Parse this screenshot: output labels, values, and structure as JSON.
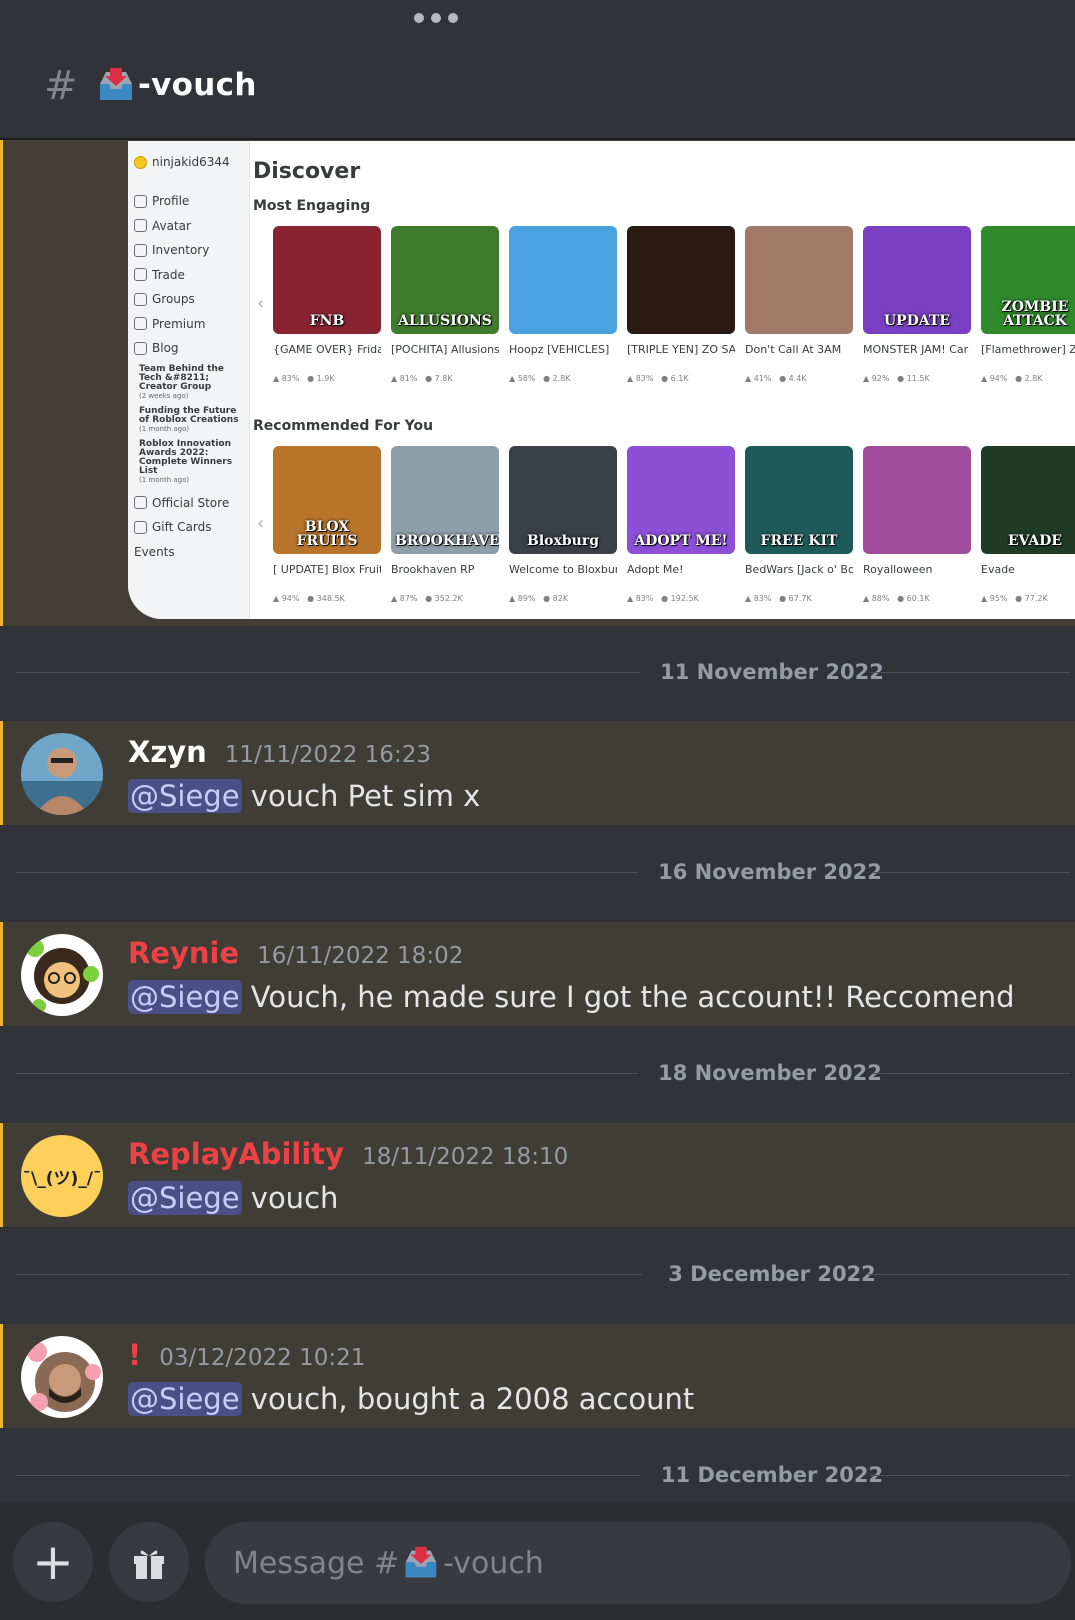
{
  "header": {
    "channel_prefix": "#",
    "channel_name": "-vouch",
    "menu_icon": "more-dots-icon",
    "channel_emoji": "inbox-tray-icon"
  },
  "embed": {
    "roblox": {
      "username": "ninjakid6344",
      "nav": [
        "Profile",
        "Avatar",
        "Inventory",
        "Trade",
        "Groups",
        "Premium",
        "Blog"
      ],
      "news": [
        {
          "title": "Team Behind the Tech &#8211; Creator Group",
          "age": "(2 weeks ago)"
        },
        {
          "title": "Funding the Future of Roblox Creations",
          "age": "(1 month ago)"
        },
        {
          "title": "Roblox Innovation Awards 2022: Complete Winners List",
          "age": "(1 month ago)"
        }
      ],
      "nav_bottom": [
        "Official Store",
        "Gift Cards",
        "Events"
      ],
      "page_title": "Discover",
      "section_1": "Most Engaging",
      "section_2": "Recommended For You",
      "most_engaging": [
        {
          "title": "{GAME OVER} Friday Night",
          "rating": "83%",
          "players": "1.9K",
          "thumb_text": "FNB",
          "color": "#8a2331"
        },
        {
          "title": "[POCHITA] Allusions",
          "rating": "81%",
          "players": "7.8K",
          "thumb_text": "ALLUSIONS",
          "color": "#3f7d2c"
        },
        {
          "title": "Hoopz [VEHICLES]",
          "rating": "58%",
          "players": "2.8K",
          "thumb_text": "",
          "color": "#4aa3e0"
        },
        {
          "title": "[TRIPLE YEN] ZO SAMURAI",
          "rating": "83%",
          "players": "6.1K",
          "thumb_text": "",
          "color": "#2a1a12"
        },
        {
          "title": "Don't Call At 3AM",
          "rating": "41%",
          "players": "4.4K",
          "thumb_text": "",
          "color": "#a07a66"
        },
        {
          "title": "MONSTER JAM! Car",
          "rating": "92%",
          "players": "11.5K",
          "thumb_text": "UPDATE",
          "color": "#7a3fc2"
        },
        {
          "title": "[Flamethrower] Zombie Attack",
          "rating": "94%",
          "players": "2.8K",
          "thumb_text": "ZOMBIE ATTACK",
          "color": "#2f8a2c"
        }
      ],
      "recommended": [
        {
          "title": "[ UPDATE] Blox Fruits",
          "rating": "94%",
          "players": "348.5K",
          "thumb_text": "BLOX FRUITS",
          "color": "#b8742a"
        },
        {
          "title": "Brookhaven RP",
          "rating": "87%",
          "players": "352.2K",
          "thumb_text": "BROOKHAVEN",
          "color": "#8e9ea8"
        },
        {
          "title": "Welcome to Bloxburg",
          "rating": "89%",
          "players": "82K",
          "thumb_text": "Bloxburg",
          "color": "#3b3f46"
        },
        {
          "title": "Adopt Me!",
          "rating": "83%",
          "players": "192.5K",
          "thumb_text": "ADOPT ME!",
          "color": "#8c4fd6"
        },
        {
          "title": "BedWars [Jack o' Boom!]",
          "rating": "83%",
          "players": "67.7K",
          "thumb_text": "FREE KIT",
          "color": "#1f5a5a"
        },
        {
          "title": "Royalloween",
          "rating": "88%",
          "players": "60.1K",
          "thumb_text": "",
          "color": "#a04b9e"
        },
        {
          "title": "Evade",
          "rating": "95%",
          "players": "77.2K",
          "thumb_text": "EVADE",
          "color": "#1f3b24"
        }
      ]
    }
  },
  "dividers": [
    {
      "label": "11 November 2022"
    },
    {
      "label": "16 November 2022"
    },
    {
      "label": "18 November 2022"
    },
    {
      "label": "3 December 2022"
    },
    {
      "label": "11 December 2022"
    }
  ],
  "messages": [
    {
      "author": "Xzyn",
      "author_color": "#ffffff",
      "timestamp": "11/11/2022 16:23",
      "mention": "@Siege",
      "text": "vouch Pet sim x"
    },
    {
      "author": "Reynie",
      "author_color": "#ed4245",
      "timestamp": "16/11/2022 18:02",
      "mention": "@Siege",
      "text": "Vouch, he made sure I got the account!! Reccomend"
    },
    {
      "author": "ReplayAbility",
      "author_color": "#ed4245",
      "timestamp": "18/11/2022 18:10",
      "mention": "@Siege",
      "text": "vouch",
      "avatar_text": "¯\\_(ツ)_/¯"
    },
    {
      "author": "!",
      "author_color": "#ed4245",
      "timestamp": "03/12/2022 10:21",
      "mention": "@Siege",
      "text": "vouch, bought a 2008 account"
    }
  ],
  "composer": {
    "placeholder_prefix": "Message #",
    "placeholder_suffix": "-vouch",
    "plus_icon": "plus-icon",
    "gift_icon": "gift-icon"
  }
}
